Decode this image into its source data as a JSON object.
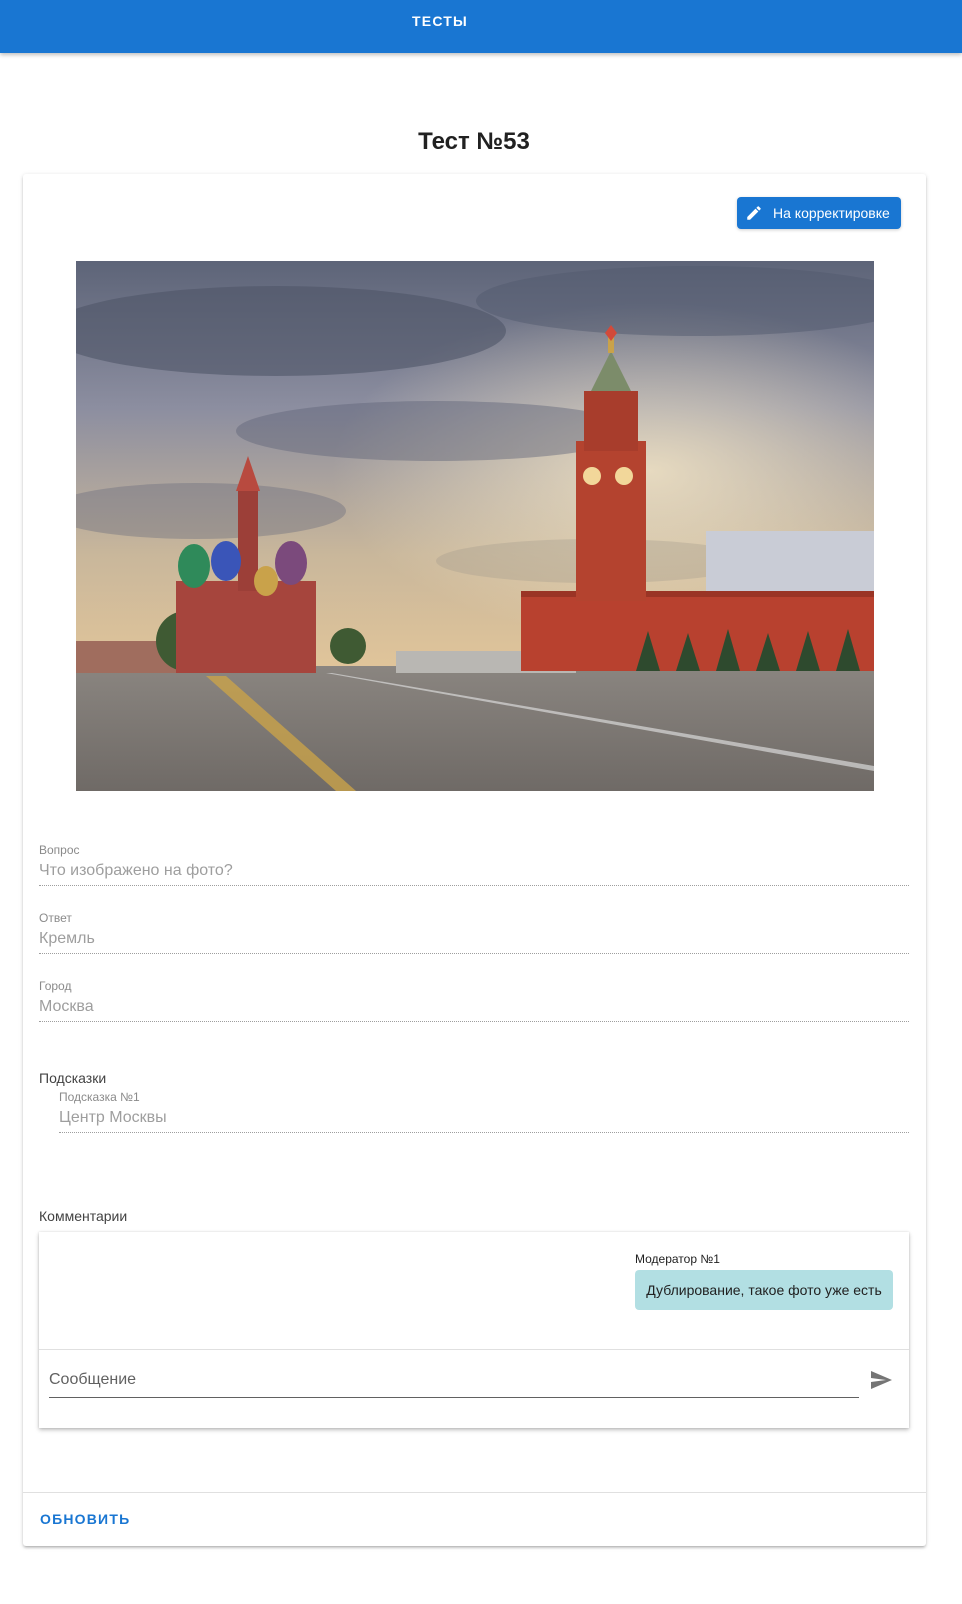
{
  "appbar": {
    "tab_label": "ТЕСТЫ",
    "color": "#1976d2"
  },
  "page": {
    "title": "Тест №53"
  },
  "status_button": {
    "label": "На корректировке",
    "icon": "pencil-icon"
  },
  "photo": {
    "subject": "kremlin-red-square-photo"
  },
  "fields": {
    "question": {
      "label": "Вопрос",
      "value": "Что изображено на фото?"
    },
    "answer": {
      "label": "Ответ",
      "value": "Кремль"
    },
    "city": {
      "label": "Город",
      "value": "Москва"
    }
  },
  "hints": {
    "title": "Подсказки",
    "items": [
      {
        "label": "Подсказка №1",
        "value": "Центр Москвы"
      }
    ]
  },
  "comments": {
    "title": "Комментарии",
    "messages": [
      {
        "author": "Модератор №1",
        "text": "Дублирование, такое фото уже есть",
        "bubble_color": "#b2dfe3"
      }
    ],
    "input_placeholder": "Сообщение",
    "send_icon": "send-icon"
  },
  "actions": {
    "refresh_label": "ОБНОВИТЬ"
  }
}
